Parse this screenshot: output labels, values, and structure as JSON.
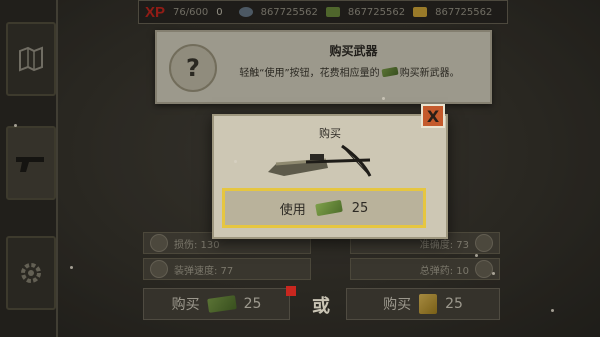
{
  "top_bar": {
    "xp_label": "XP",
    "xp_progress": "76/600",
    "level": "0",
    "currency_1": "867725562",
    "currency_2": "867725562",
    "currency_3": "867725562"
  },
  "banner": {
    "title": "购买武器",
    "text_before_icon": "轻触“使用”按钮，花费相应量的",
    "text_after_icon": "购买新武器。"
  },
  "modal": {
    "title": "购买",
    "close_label": "X",
    "use_label": "使用",
    "use_cost": "25"
  },
  "stats": {
    "damage": "损伤: 130",
    "accuracy": "准确度: 73",
    "reload": "装弹速度: 77",
    "ammo": "总弹药: 10"
  },
  "buy_row": {
    "buy_label_left": "购买",
    "cost_left": "25",
    "or_label": "或",
    "buy_label_right": "购买",
    "cost_right": "25"
  },
  "colors": {
    "xp": "#c9271f",
    "highlight": "#e6c640",
    "close": "#c45a2c",
    "cash": "#6e8e3e",
    "gold": "#d4aa3a"
  }
}
